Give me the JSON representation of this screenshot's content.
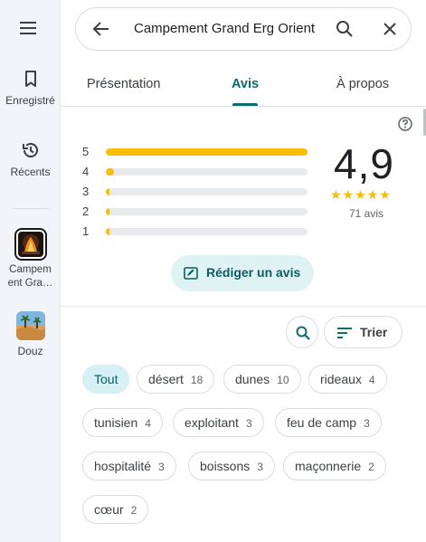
{
  "rail": {
    "menu_icon": "hamburger-icon",
    "saved_label": "Enregistré",
    "recent_label": "Récents",
    "places": [
      {
        "label": "Campem ent Gra…"
      },
      {
        "label": "Douz"
      }
    ]
  },
  "search": {
    "query": "Campement Grand Erg Orient"
  },
  "tabs": [
    {
      "label": "Présentation"
    },
    {
      "label": "Avis"
    },
    {
      "label": "À propos"
    }
  ],
  "ratings": {
    "score": "4,9",
    "stars": "★★★★★",
    "count_label": "71 avis",
    "rows": [
      {
        "label": "5",
        "fraction": 1.0
      },
      {
        "label": "4",
        "fraction": 0.04
      },
      {
        "label": "3",
        "fraction": 0.0
      },
      {
        "label": "2",
        "fraction": 0.0
      },
      {
        "label": "1",
        "fraction": 0.02
      }
    ]
  },
  "write_review_label": "Rédiger un avis",
  "sort_label": "Trier",
  "chips": [
    {
      "label": "Tout",
      "count": ""
    },
    {
      "label": "désert",
      "count": "18"
    },
    {
      "label": "dunes",
      "count": "10"
    },
    {
      "label": "rideaux",
      "count": "4"
    },
    {
      "label": "tunisien",
      "count": "4"
    },
    {
      "label": "exploitant",
      "count": "3"
    },
    {
      "label": "feu de camp",
      "count": "3"
    },
    {
      "label": "hospitalité",
      "count": "3"
    },
    {
      "label": "boissons",
      "count": "3"
    },
    {
      "label": "maçonnerie",
      "count": "2"
    },
    {
      "label": "cœur",
      "count": "2"
    }
  ],
  "colors": {
    "accent": "#0b6e6e",
    "star": "#fbbc04",
    "chip_active_bg": "#d6f0f5"
  }
}
